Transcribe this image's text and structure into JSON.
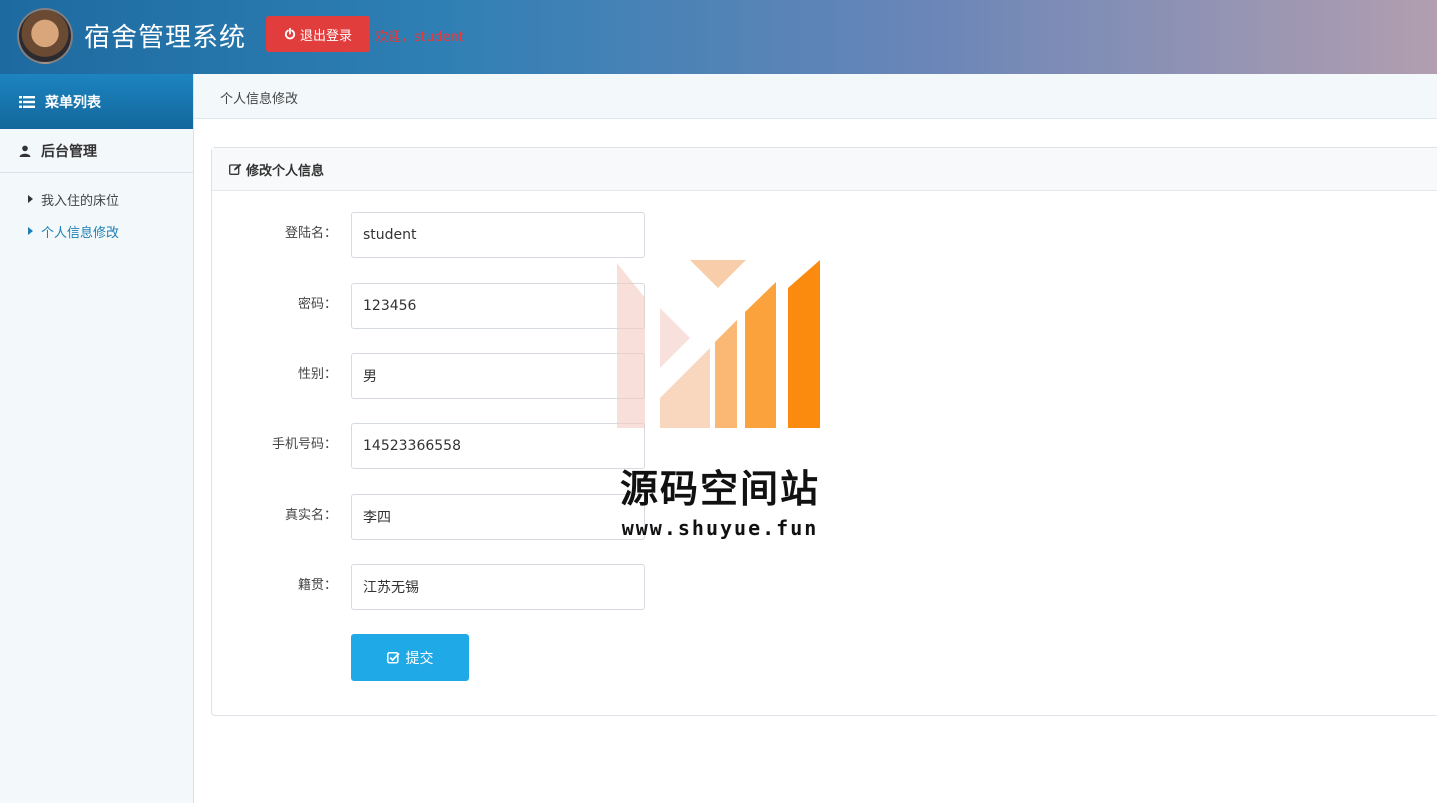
{
  "header": {
    "app_title": "宿舍管理系统",
    "logout_label": "退出登录",
    "welcome_text": "欢迎，student",
    "accent_color": "#e13d3d"
  },
  "sidebar": {
    "menu_title": "菜单列表",
    "group_title": "后台管理",
    "items": [
      {
        "label": "我入住的床位",
        "active": false
      },
      {
        "label": "个人信息修改",
        "active": true
      }
    ]
  },
  "breadcrumb": {
    "current": "个人信息修改"
  },
  "panel": {
    "title": "修改个人信息",
    "fields": [
      {
        "label": "登陆名：",
        "value": "student"
      },
      {
        "label": "密码：",
        "value": "123456"
      },
      {
        "label": "性别：",
        "value": "男"
      },
      {
        "label": "手机号码：",
        "value": "14523366558"
      },
      {
        "label": "真实名：",
        "value": "李四"
      },
      {
        "label": "籍贯：",
        "value": "江苏无锡"
      }
    ],
    "submit_label": "提交"
  },
  "watermark": {
    "title": "源码空间站",
    "url": "www.shuyue.fun"
  },
  "icons": {
    "logout": "power-icon",
    "menu": "list-icon",
    "group": "user-icon",
    "panel": "edit-icon",
    "submit": "check-square-icon"
  }
}
